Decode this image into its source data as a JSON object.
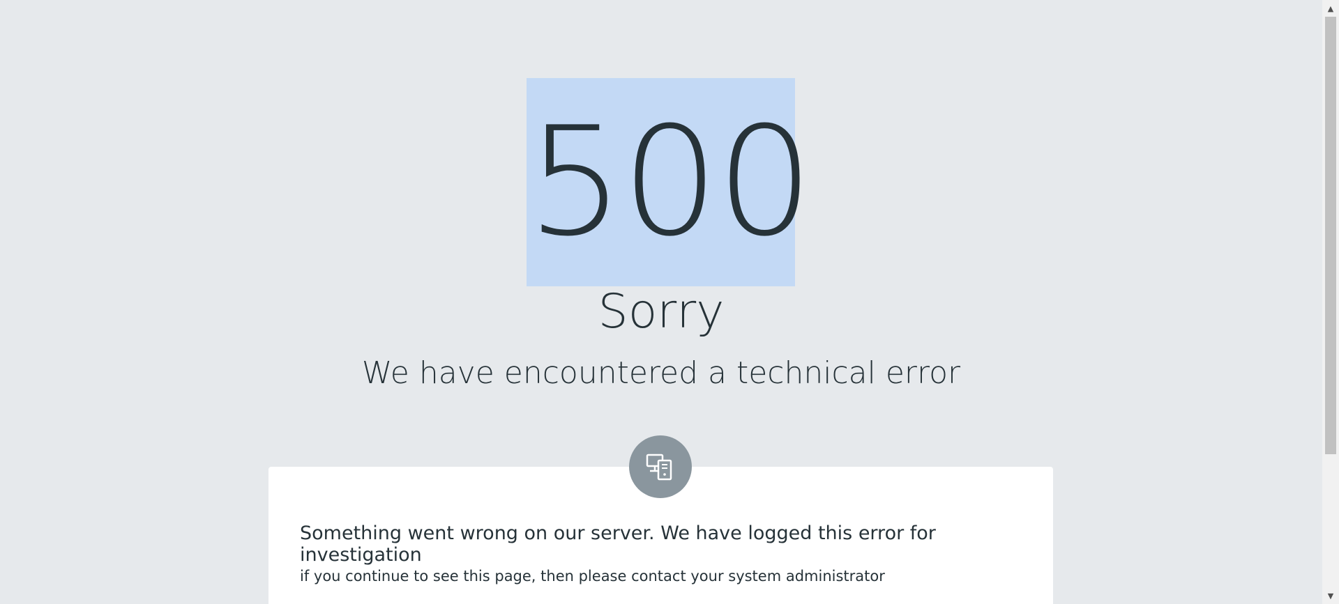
{
  "error": {
    "code": "500",
    "heading": "Sorry",
    "subheading": "We have encountered a technical error"
  },
  "card": {
    "icon": "server-icon",
    "message": "Something went wrong on our server. We have logged this error for investigation",
    "hint": "if you continue to see this page, then please contact your system administrator"
  },
  "scrollbar": {
    "up_arrow": "▲",
    "down_arrow": "▼"
  },
  "colors": {
    "background": "#e6e9ec",
    "selection_highlight": "#c3d9f5",
    "text": "#263238",
    "badge": "#8a969e",
    "card": "#ffffff"
  }
}
